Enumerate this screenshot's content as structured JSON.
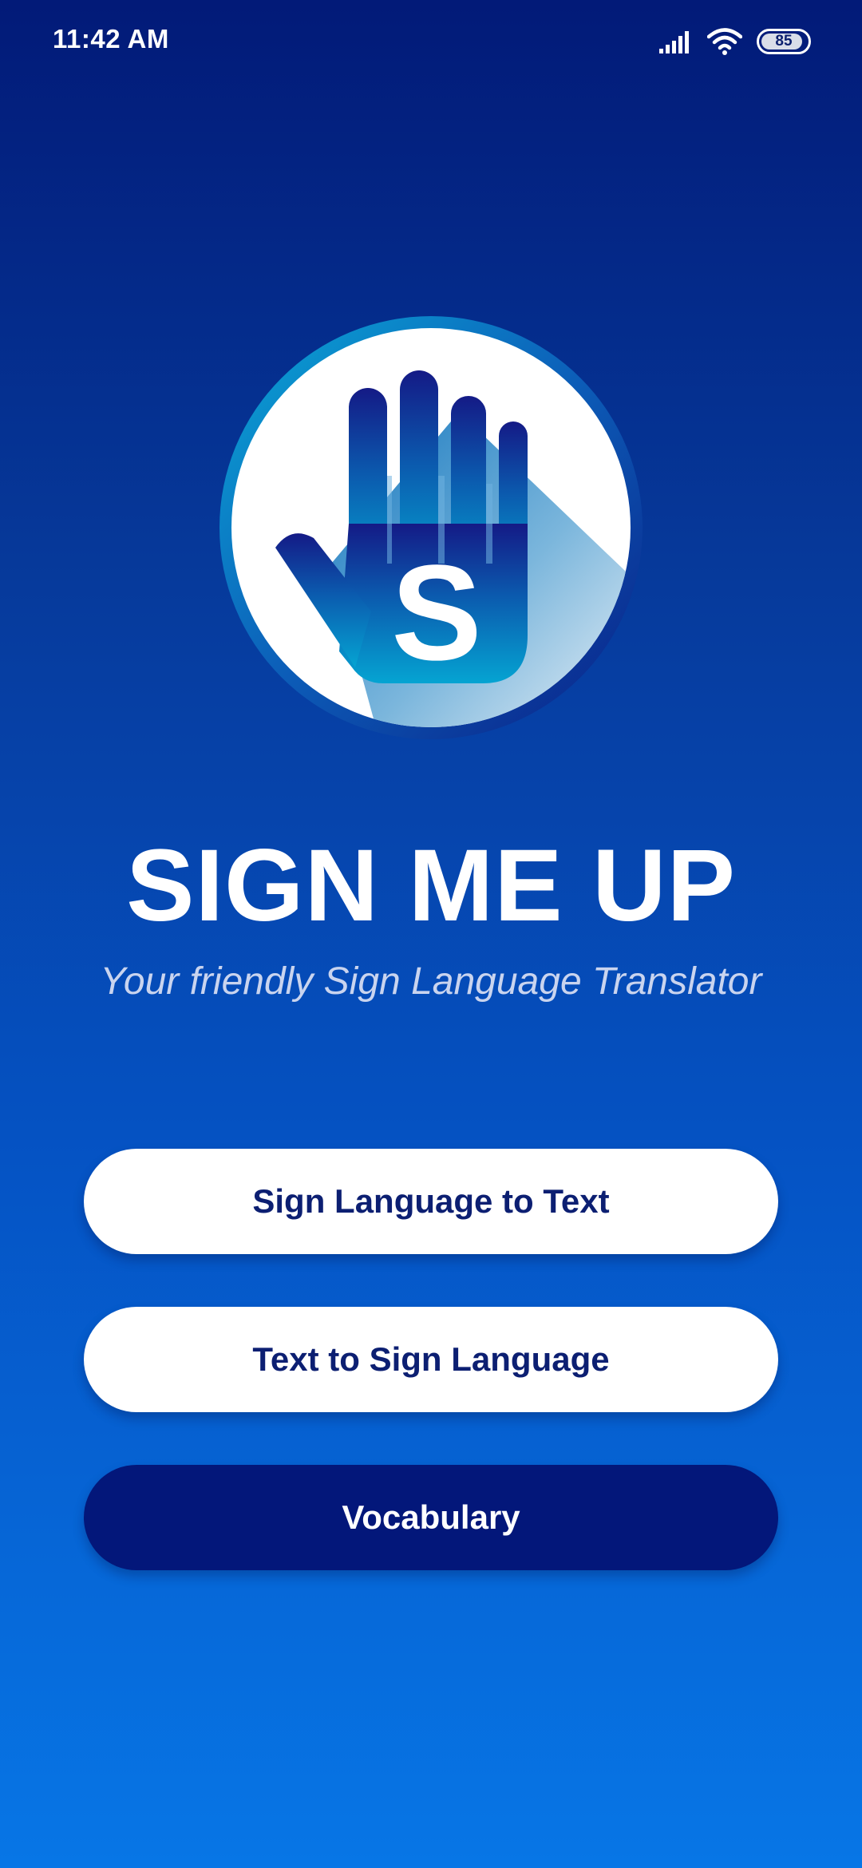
{
  "status_bar": {
    "time": "11:42 AM",
    "battery_level": "85",
    "icons": [
      "signal-icon",
      "wifi-icon",
      "battery-icon"
    ]
  },
  "app": {
    "logo_icon": "hand-s-logo-icon",
    "logo_letter": "S",
    "title": "SIGN ME UP",
    "subtitle": "Your friendly Sign Language Translator"
  },
  "menu": {
    "sign_to_text_label": "Sign Language to Text",
    "text_to_sign_label": "Text to Sign Language",
    "vocabulary_label": "Vocabulary"
  },
  "colors": {
    "background_top": "#021a78",
    "background_bottom": "#0776e6",
    "button_light": "#ffffff",
    "button_light_text": "#0c1f72",
    "button_dark": "#03177a",
    "button_dark_text": "#ffffff"
  }
}
